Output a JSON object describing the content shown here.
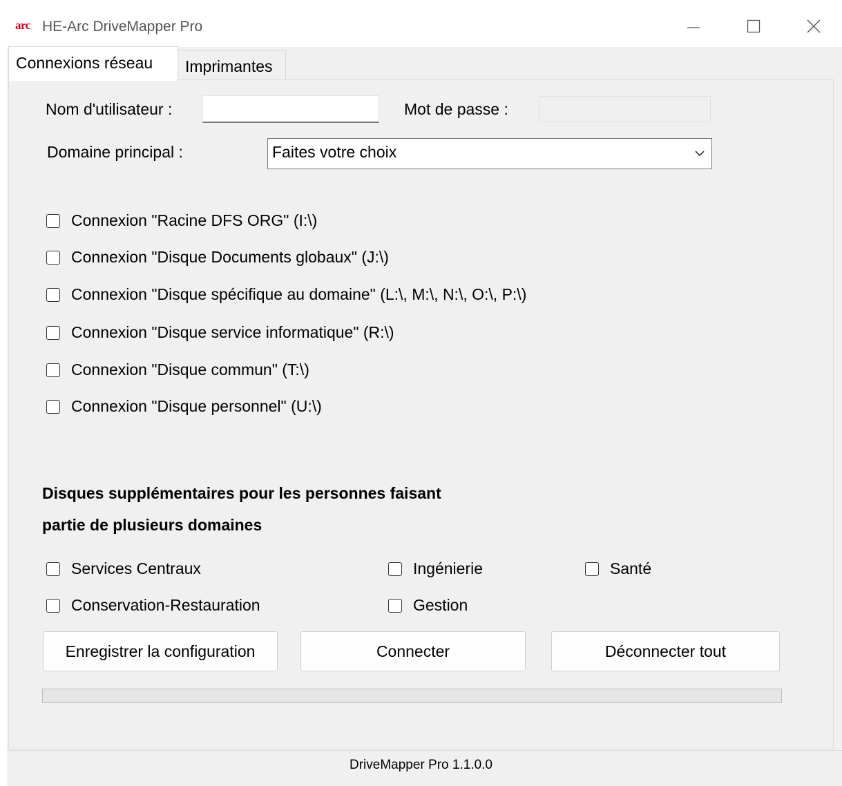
{
  "window": {
    "logo_text": "arc",
    "title": "HE-Arc DriveMapper Pro"
  },
  "tabs": [
    {
      "label": "Connexions réseau",
      "active": true
    },
    {
      "label": "Imprimantes",
      "active": false
    }
  ],
  "form": {
    "username_label": "Nom d'utilisateur :",
    "username_value": "",
    "password_label": "Mot de passe :",
    "password_value": "",
    "domain_label": "Domaine principal :",
    "domain_selected": "Faites votre choix"
  },
  "connections": [
    {
      "label": "Connexion \"Racine DFS ORG\" (I:\\)",
      "checked": false
    },
    {
      "label": "Connexion \"Disque Documents globaux\" (J:\\)",
      "checked": false
    },
    {
      "label": "Connexion \"Disque spécifique au domaine\" (L:\\, M:\\, N:\\, O:\\, P:\\)",
      "checked": false
    },
    {
      "label": "Connexion \"Disque service informatique\" (R:\\)",
      "checked": false
    },
    {
      "label": "Connexion \"Disque commun\" (T:\\)",
      "checked": false
    },
    {
      "label": "Connexion \"Disque personnel\" (U:\\)",
      "checked": false
    }
  ],
  "extra": {
    "title_line1": "Disques supplémentaires pour les personnes faisant",
    "title_line2": "partie de plusieurs domaines",
    "domains": [
      {
        "label": "Services Centraux",
        "checked": false
      },
      {
        "label": "Ingénierie",
        "checked": false
      },
      {
        "label": "Santé",
        "checked": false
      },
      {
        "label": "Conservation-Restauration",
        "checked": false
      },
      {
        "label": "Gestion",
        "checked": false
      }
    ]
  },
  "buttons": {
    "save": "Enregistrer la configuration",
    "connect": "Connecter",
    "disconnect_all": "Déconnecter tout"
  },
  "progress": {
    "value": 0
  },
  "status": {
    "text": "DriveMapper Pro 1.1.0.0"
  },
  "colors": {
    "logo": "#d0021b",
    "window_bg": "#f0f0f0"
  }
}
